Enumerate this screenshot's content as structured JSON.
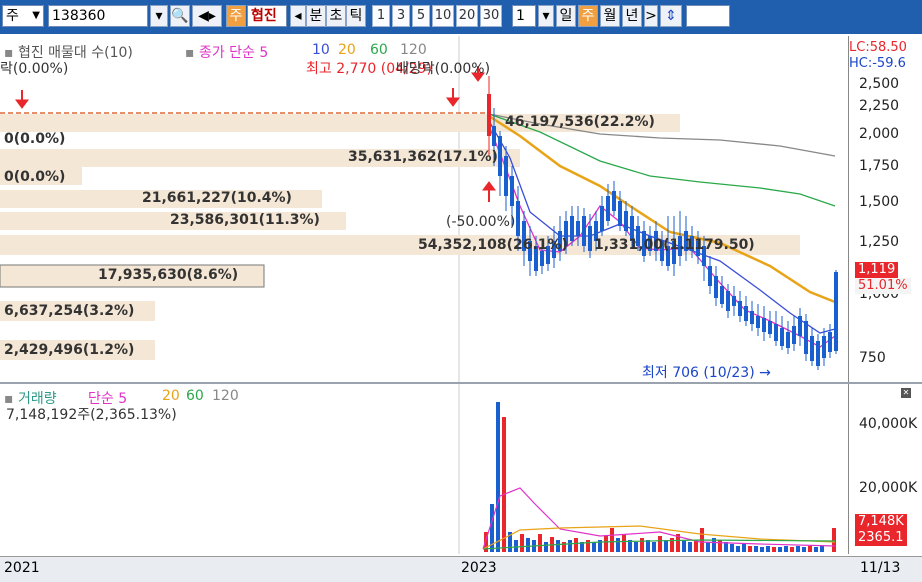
{
  "toolbar": {
    "period_select": "주",
    "code_value": "138360",
    "stock_tag": "주",
    "stock_name": "협진",
    "btn_min": "분",
    "btn_tick": "초",
    "btn_tick2": "틱",
    "intervals": [
      "1",
      "3",
      "5",
      "10",
      "20",
      "30"
    ],
    "interval_select": "1",
    "btn_day": "일",
    "btn_week": "주",
    "btn_month": "월",
    "btn_year": "년"
  },
  "price_panel": {
    "legend_title": "협진 매물대 수(10)",
    "legend_ma": "종가 단순",
    "ma_periods": [
      "5",
      "10",
      "20",
      "60",
      "120"
    ],
    "left_top_text": "락(0.00%)",
    "high_label": "최고 2,770 (04/29)",
    "high_overlap": "배당락(0.00%)",
    "low_label": "최저 706 (10/23)",
    "mid_label": "(-50.00%)",
    "lc_label": "LC:58.50",
    "hc_label": "HC:-59.6",
    "price_badge": "1,119",
    "price_badge2": "51.01%",
    "volume_profile": [
      "0(0.0%)",
      "0(0.0%)",
      "21,661,227(10.4%)",
      "23,586,301(11.3%)",
      "17,935,630(8.6%)",
      "6,637,254(3.2%)",
      "2,429,496(1.2%)"
    ],
    "profile_right": [
      "46,197,536(22.2%)",
      "35,631,362(17.1%)",
      "54,352,108(26.1%)",
      "1,331,00(1.1179.50)"
    ]
  },
  "volume_panel": {
    "legend_title": "거래량",
    "legend_ma": "단순",
    "ma_periods": [
      "5",
      "20",
      "60",
      "120"
    ],
    "vol_text": "7,148,192주(2,365.13%)",
    "badge_vol": "7,148K",
    "badge_pct": "2365.1"
  },
  "axis": {
    "price_ticks": [
      "2,500",
      "2,250",
      "2,000",
      "1,750",
      "1,500",
      "1,250",
      "1,000",
      "750"
    ],
    "vol_ticks": [
      "40,000K",
      "20,000K"
    ]
  },
  "dates": [
    "2021",
    "2023",
    "11/13"
  ],
  "colors": {
    "toolbar_bg": "#1f5fae",
    "candle_up": "#e8262b",
    "candle_down": "#1a5fd0",
    "ma5": "#e032c9",
    "ma10": "#3a4ed8",
    "ma20": "#e8a317",
    "ma60": "#2aa84a",
    "ma120": "#888888",
    "profile_bar": "#f5e7d6"
  }
}
